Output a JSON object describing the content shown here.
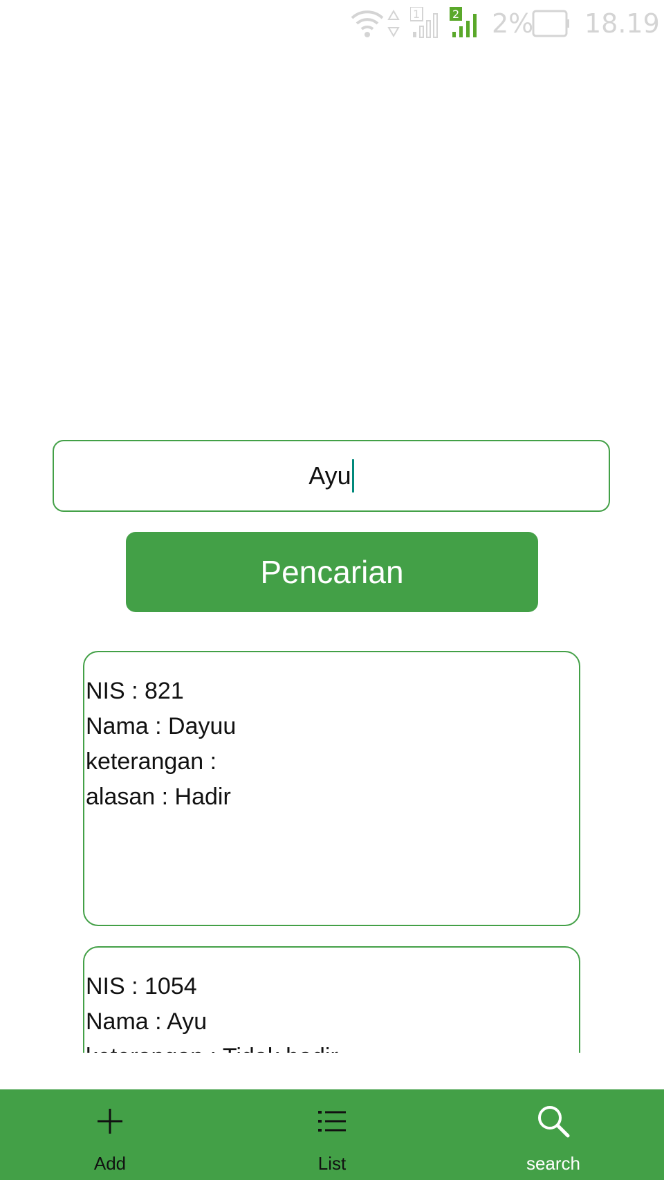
{
  "status_bar": {
    "battery": "2%",
    "time": "18.19",
    "sim1": "1",
    "sim2": "2"
  },
  "search": {
    "value": "Ayu",
    "button_label": "Pencarian"
  },
  "results": [
    {
      "nis": "NIS : 821",
      "nama": "Nama : Dayuu",
      "keterangan": "keterangan :",
      "alasan": "alasan : Hadir"
    },
    {
      "nis": "NIS : 1054",
      "nama": "Nama : Ayu",
      "keterangan": "keterangan : Tidak hadir",
      "alasan": ""
    }
  ],
  "bottom_nav": {
    "items": [
      {
        "label": "Add",
        "icon": "plus-icon"
      },
      {
        "label": "List",
        "icon": "list-icon"
      },
      {
        "label": "search",
        "icon": "search-icon"
      }
    ]
  },
  "colors": {
    "accent": "#43a047",
    "caret": "#00897b",
    "status_icons": "#d4d4d4"
  }
}
